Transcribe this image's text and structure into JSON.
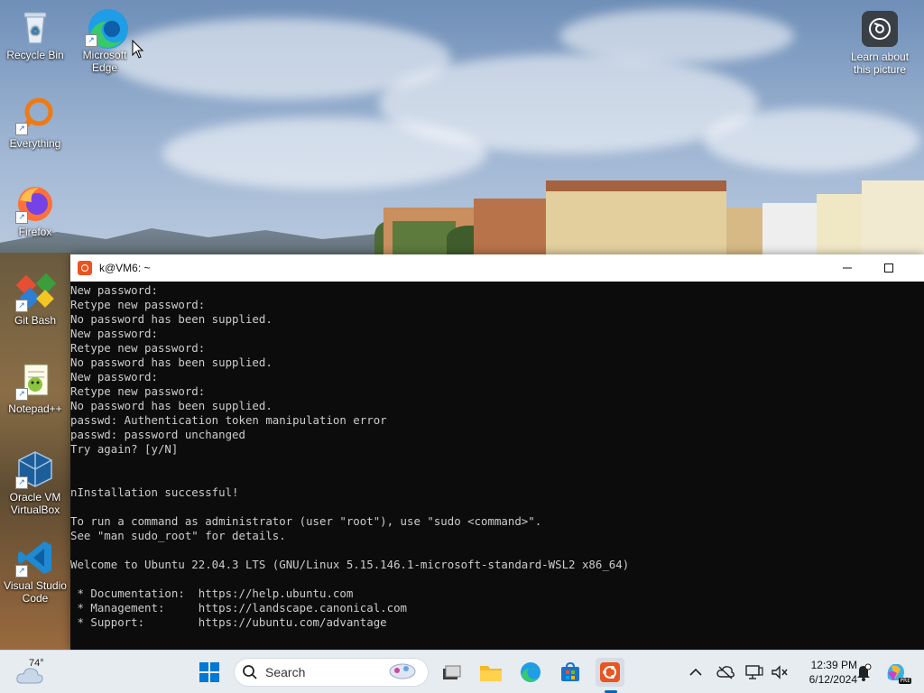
{
  "desktop": {
    "icons": [
      {
        "label": "Recycle Bin"
      },
      {
        "label": "Microsoft Edge"
      },
      {
        "label": "Everything"
      },
      {
        "label": "Firefox"
      },
      {
        "label": "Git Bash"
      },
      {
        "label": "Notepad++"
      },
      {
        "label": "Oracle VM VirtualBox"
      },
      {
        "label": "Visual Studio Code"
      }
    ],
    "learn_about": {
      "label_line1": "Learn about",
      "label_line2": "this picture"
    }
  },
  "terminal": {
    "title": "k@VM6: ~",
    "lines": [
      "New password:",
      "Retype new password:",
      "No password has been supplied.",
      "New password:",
      "Retype new password:",
      "No password has been supplied.",
      "New password:",
      "Retype new password:",
      "No password has been supplied.",
      "passwd: Authentication token manipulation error",
      "passwd: password unchanged",
      "Try again? [y/N]",
      "",
      "",
      "nInstallation successful!",
      "",
      "To run a command as administrator (user \"root\"), use \"sudo <command>\".",
      "See \"man sudo_root\" for details.",
      "",
      "Welcome to Ubuntu 22.04.3 LTS (GNU/Linux 5.15.146.1-microsoft-standard-WSL2 x86_64)",
      "",
      " * Documentation:  https://help.ubuntu.com",
      " * Management:     https://landscape.canonical.com",
      " * Support:        https://ubuntu.com/advantage"
    ]
  },
  "taskbar": {
    "weather_temp": "74°",
    "search_label": "Search",
    "clock_time": "12:39 PM",
    "clock_date": "6/12/2024",
    "copilot_badge": "PRE",
    "accent": "#0067c0"
  }
}
